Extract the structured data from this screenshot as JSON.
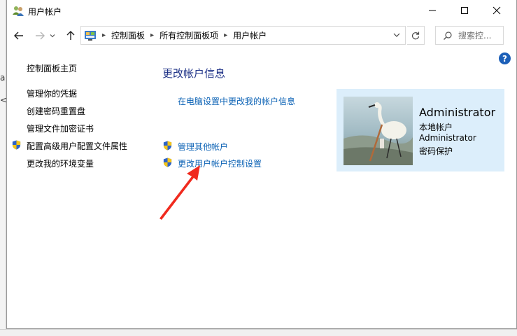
{
  "window": {
    "title": "用户帐户",
    "minimize_icon": "minimize-icon",
    "maximize_icon": "maximize-icon",
    "close_icon": "close-icon"
  },
  "navigation": {
    "breadcrumbs": [
      "控制面板",
      "所有控制面板项",
      "用户帐户"
    ],
    "search_placeholder": "搜索控..."
  },
  "sidebar": {
    "items": [
      {
        "label": "控制面板主页",
        "shield": false
      },
      {
        "label": "管理你的凭据",
        "shield": false
      },
      {
        "label": "创建密码重置盘",
        "shield": false
      },
      {
        "label": "管理文件加密证书",
        "shield": false
      },
      {
        "label": "配置高级用户配置文件属性",
        "shield": true
      },
      {
        "label": "更改我的环境变量",
        "shield": false
      }
    ]
  },
  "main": {
    "title": "更改帐户信息",
    "links": [
      {
        "label": "在电脑设置中更改我的帐户信息",
        "shield": false
      },
      {
        "label": "管理其他帐户",
        "shield": true
      },
      {
        "label": "更改用户帐户控制设置",
        "shield": true
      }
    ]
  },
  "account": {
    "name": "Administrator",
    "type": "本地帐户",
    "group": "Administrator",
    "status": "密码保护"
  },
  "colors": {
    "link": "#0b62b5",
    "title": "#1e3287",
    "card_bg": "#dceefb",
    "help": "#1c5fb8",
    "annotation_arrow": "#f02a1e"
  }
}
